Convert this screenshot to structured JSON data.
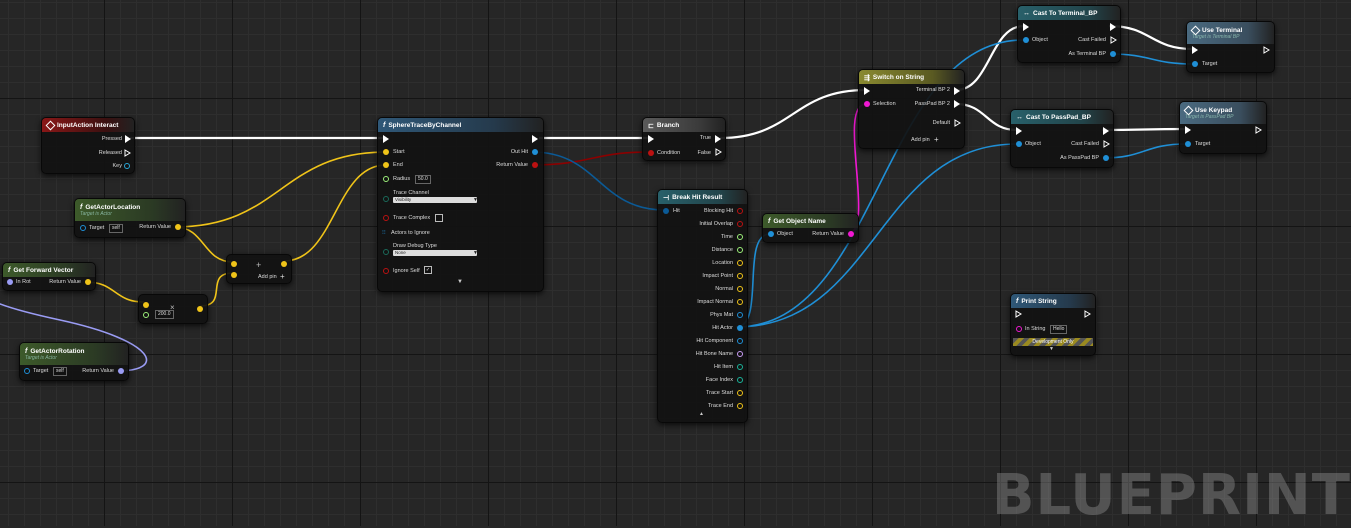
{
  "watermark": "BLUEPRINT",
  "colors": {
    "exec": "#ffffff",
    "bool": "#8c0000",
    "object": "#1f8fd6",
    "vector": "#f0c419",
    "float": "#9cf07a",
    "string": "#f018d2",
    "rotator": "#9a9cf4",
    "struct": "#0b5a96"
  },
  "nodes": {
    "input_action": {
      "title": "InputAction Interact",
      "pins": {
        "pressed": "Pressed",
        "released": "Released",
        "key": "Key"
      }
    },
    "get_actor_location": {
      "title": "GetActorLocation",
      "subtitle": "Target is Actor",
      "target": "Target",
      "self": "self",
      "return": "Return Value"
    },
    "get_forward_vector": {
      "title": "Get Forward Vector",
      "inrot": "In Rot",
      "return": "Return Value"
    },
    "get_actor_rotation": {
      "title": "GetActorRotation",
      "subtitle": "Target is Actor",
      "target": "Target",
      "self": "self",
      "return": "Return Value"
    },
    "multiply": {
      "symbol": "×",
      "value": "200.0"
    },
    "add": {
      "symbol": "+",
      "addpin": "Add pin"
    },
    "sphere_trace": {
      "title": "SphereTraceByChannel",
      "start": "Start",
      "end": "End",
      "radius": "Radius",
      "radius_value": "50.0",
      "trace_channel": "Trace Channel",
      "trace_channel_value": "Visibility",
      "trace_complex": "Trace Complex",
      "actors_to_ignore": "Actors to Ignore",
      "draw_debug": "Draw Debug Type",
      "draw_debug_value": "None",
      "ignore_self": "Ignore Self",
      "out_hit": "Out Hit",
      "return": "Return Value"
    },
    "branch": {
      "title": "Branch",
      "condition": "Condition",
      "true": "True",
      "false": "False"
    },
    "break_hit": {
      "title": "Break Hit Result",
      "hit": "Hit",
      "outputs": [
        "Blocking Hit",
        "Initial Overlap",
        "Time",
        "Distance",
        "Location",
        "Impact Point",
        "Normal",
        "Impact Normal",
        "Phys Mat",
        "Hit Actor",
        "Hit Component",
        "Hit Bone Name",
        "Hit Item",
        "Face Index",
        "Trace Start",
        "Trace End"
      ]
    },
    "get_object_name": {
      "title": "Get Object Name",
      "object": "Object",
      "return": "Return Value"
    },
    "switch_string": {
      "title": "Switch on String",
      "selection": "Selection",
      "case1": "Terminal BP 2",
      "case2": "PassPad BP 2",
      "default": "Default",
      "addpin": "Add pin"
    },
    "cast_terminal": {
      "title": "Cast To Terminal_BP",
      "object": "Object",
      "cast_failed": "Cast Failed",
      "as": "As Terminal BP"
    },
    "cast_passpad": {
      "title": "Cast To PassPad_BP",
      "object": "Object",
      "cast_failed": "Cast Failed",
      "as": "As PassPad BP"
    },
    "use_terminal": {
      "title": "Use Terminal",
      "subtitle": "Target is Terminal BP",
      "target": "Target"
    },
    "use_keypad": {
      "title": "Use Keypad",
      "subtitle": "Target is PassPad BP",
      "target": "Target"
    },
    "print_string": {
      "title": "Print String",
      "in_string": "In String",
      "in_string_value": "Hello",
      "dev_only": "Development Only"
    }
  }
}
